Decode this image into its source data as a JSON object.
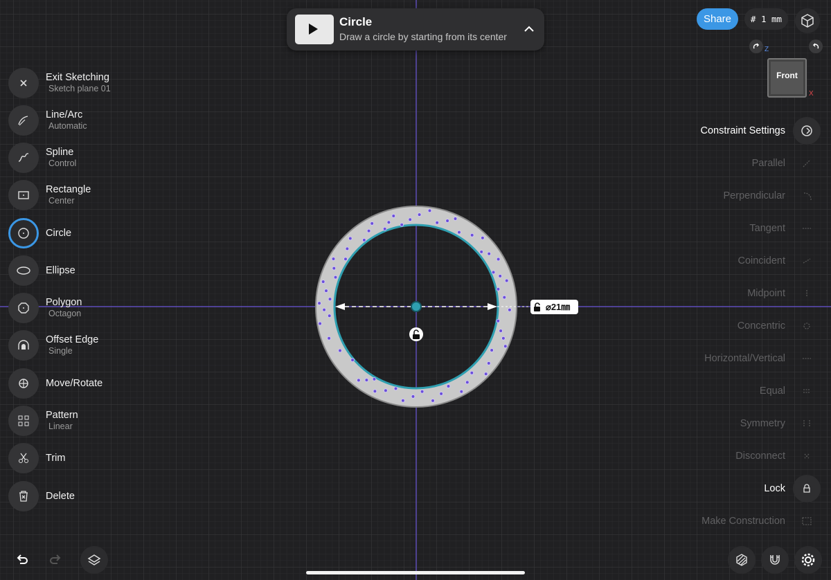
{
  "banner": {
    "title": "Circle",
    "subtitle": "Draw a circle by starting from its center"
  },
  "tools": [
    {
      "name": "Exit Sketching",
      "sub": "Sketch plane 01",
      "icon": "close-icon"
    },
    {
      "name": "Line/Arc",
      "sub": "Automatic",
      "icon": "line-arc-icon"
    },
    {
      "name": "Spline",
      "sub": "Control",
      "icon": "spline-icon"
    },
    {
      "name": "Rectangle",
      "sub": "Center",
      "icon": "rectangle-icon"
    },
    {
      "name": "Circle",
      "sub": "",
      "icon": "circle-icon",
      "active": true
    },
    {
      "name": "Ellipse",
      "sub": "",
      "icon": "ellipse-icon"
    },
    {
      "name": "Polygon",
      "sub": "Octagon",
      "icon": "polygon-icon"
    },
    {
      "name": "Offset Edge",
      "sub": "Single",
      "icon": "offset-edge-icon"
    },
    {
      "name": "Move/Rotate",
      "sub": "",
      "icon": "move-rotate-icon"
    },
    {
      "name": "Pattern",
      "sub": "Linear",
      "icon": "pattern-icon"
    },
    {
      "name": "Trim",
      "sub": "",
      "icon": "scissors-icon"
    },
    {
      "name": "Delete",
      "sub": "",
      "icon": "trash-icon"
    }
  ],
  "header": {
    "share_label": "Share",
    "grid_label": "# 1 mm"
  },
  "view_cube": {
    "face": "Front",
    "axis_z": "Z",
    "axis_x": "X"
  },
  "constraints": {
    "title": "Constraint Settings",
    "items": [
      {
        "label": "Parallel",
        "enabled": false
      },
      {
        "label": "Perpendicular",
        "enabled": false
      },
      {
        "label": "Tangent",
        "enabled": false
      },
      {
        "label": "Coincident",
        "enabled": false
      },
      {
        "label": "Midpoint",
        "enabled": false
      },
      {
        "label": "Concentric",
        "enabled": false
      },
      {
        "label": "Horizontal/Vertical",
        "enabled": false
      },
      {
        "label": "Equal",
        "enabled": false
      },
      {
        "label": "Symmetry",
        "enabled": false
      },
      {
        "label": "Disconnect",
        "enabled": false
      },
      {
        "label": "Lock",
        "enabled": true
      },
      {
        "label": "Make Construction",
        "enabled": false
      }
    ]
  },
  "dimension": {
    "value": "⌀21㎜"
  },
  "colors": {
    "accent": "#3b97e5",
    "axis": "#7a5cf0",
    "circle": "#2f9fb0"
  }
}
